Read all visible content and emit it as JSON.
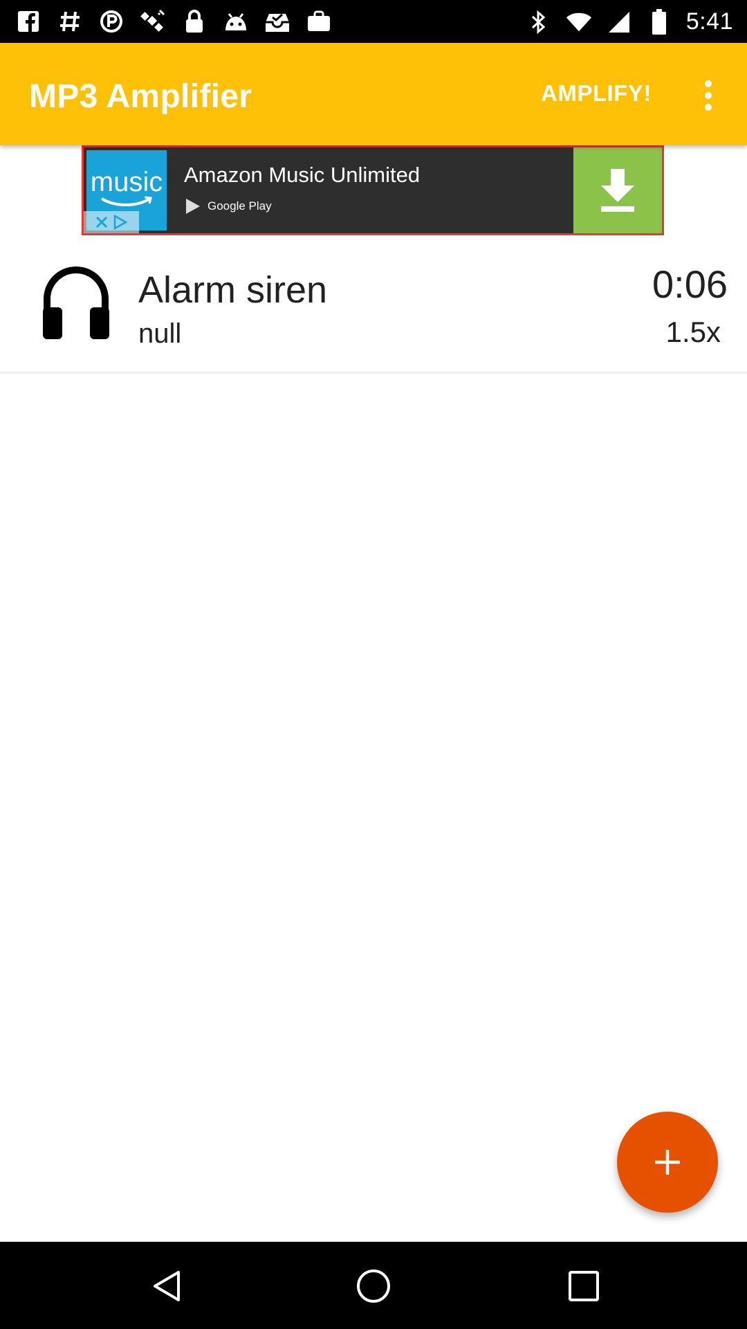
{
  "status_bar": {
    "time": "5:41",
    "left_icons": [
      "facebook-icon",
      "hashtag-icon",
      "circle-p-icon",
      "satellite-icon",
      "lock-icon",
      "android-icon",
      "checkbox-tray-icon",
      "bag-icon"
    ],
    "right_icons": [
      "bluetooth-icon",
      "wifi-icon",
      "signal-icon",
      "battery-icon"
    ]
  },
  "app_bar": {
    "title": "MP3 Amplifier",
    "amplify_label": "AMPLIFY!",
    "background_color": "#FFC107"
  },
  "ad": {
    "logo_text": "music",
    "title": "Amazon Music Unlimited",
    "store_label": "Google Play",
    "download_color": "#8BC34A"
  },
  "tracks": [
    {
      "title": "Alarm siren",
      "artist": "null",
      "duration": "0:06",
      "speed": "1.5x"
    }
  ],
  "fab": {
    "icon": "plus-icon",
    "color": "#E65100"
  },
  "nav": {
    "icons": [
      "back-icon",
      "home-icon",
      "recents-icon"
    ]
  }
}
